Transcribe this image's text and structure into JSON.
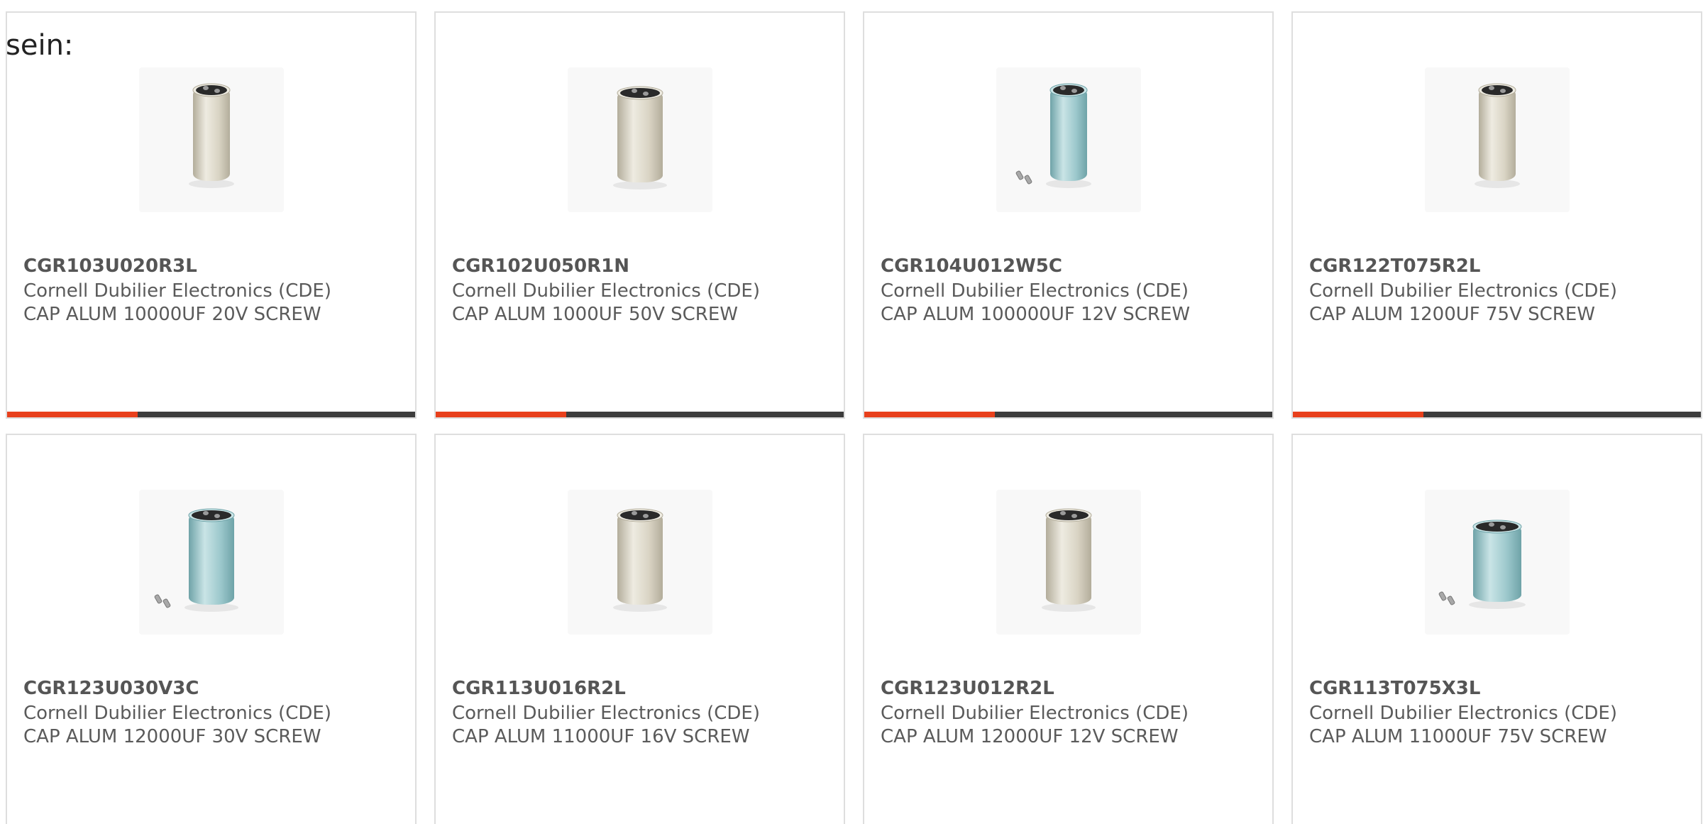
{
  "intro_text": "sein:",
  "colors": {
    "accent": "#e8401c",
    "bar": "#3c3c3c",
    "card_border": "#dedede",
    "part_number_text": "#555555",
    "body_text": "#5a5a5a"
  },
  "products": [
    {
      "part_number": "CGR103U020R3L",
      "manufacturer": "Cornell Dubilier Electronics (CDE)",
      "description": "CAP ALUM 10000UF 20V SCREW",
      "image_icon": "capacitor-silver-icon",
      "variant": "silver-tall",
      "progress": 0.32
    },
    {
      "part_number": "CGR102U050R1N",
      "manufacturer": "Cornell Dubilier Electronics (CDE)",
      "description": "CAP ALUM 1000UF 50V SCREW",
      "image_icon": "capacitor-silver-icon",
      "variant": "silver-wide",
      "progress": 0.32
    },
    {
      "part_number": "CGR104U012W5C",
      "manufacturer": "Cornell Dubilier Electronics (CDE)",
      "description": "CAP ALUM 100000UF 12V SCREW",
      "image_icon": "capacitor-teal-icon",
      "variant": "teal-tall-screws",
      "progress": 0.32
    },
    {
      "part_number": "CGR122T075R2L",
      "manufacturer": "Cornell Dubilier Electronics (CDE)",
      "description": "CAP ALUM 1200UF 75V SCREW",
      "image_icon": "capacitor-silver-icon",
      "variant": "silver-tall",
      "progress": 0.32
    },
    {
      "part_number": "CGR123U030V3C",
      "manufacturer": "Cornell Dubilier Electronics (CDE)",
      "description": "CAP ALUM 12000UF 30V SCREW",
      "image_icon": "capacitor-teal-icon",
      "variant": "teal-wide-screws",
      "progress": null
    },
    {
      "part_number": "CGR113U016R2L",
      "manufacturer": "Cornell Dubilier Electronics (CDE)",
      "description": "CAP ALUM 11000UF 16V SCREW",
      "image_icon": "capacitor-silver-icon",
      "variant": "silver-wide",
      "progress": null
    },
    {
      "part_number": "CGR123U012R2L",
      "manufacturer": "Cornell Dubilier Electronics (CDE)",
      "description": "CAP ALUM 12000UF 12V SCREW",
      "image_icon": "capacitor-silver-icon",
      "variant": "silver-wide",
      "progress": null
    },
    {
      "part_number": "CGR113T075X3L",
      "manufacturer": "Cornell Dubilier Electronics (CDE)",
      "description": "CAP ALUM 11000UF 75V SCREW",
      "image_icon": "capacitor-teal-icon",
      "variant": "teal-short-screws",
      "progress": null
    }
  ]
}
